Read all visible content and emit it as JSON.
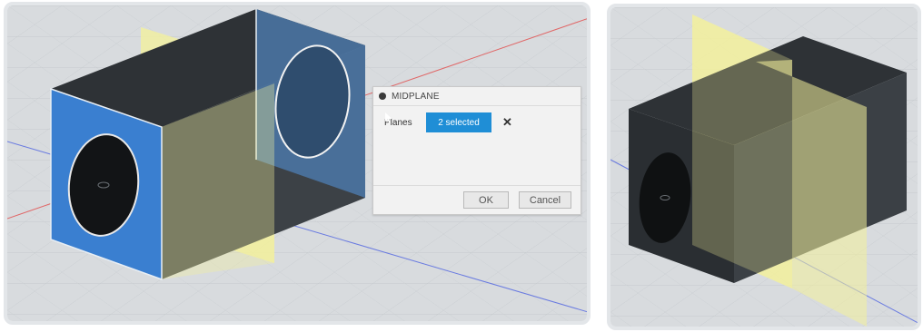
{
  "dialog": {
    "title": "MIDPLANE",
    "planes_label": "Planes",
    "selection_label": "2 selected",
    "clear_glyph": "✕",
    "ok_label": "OK",
    "cancel_label": "Cancel"
  },
  "colors": {
    "viewport_bg": "#d9dcdf",
    "grid_line": "#c3c7cb",
    "selected_face": "#3a7fd0",
    "box_dark": "#2b2f33",
    "midplane_fill": "#f4f19a",
    "select_button": "#1f8ed6",
    "axis_red": "#e35a5a",
    "axis_blue": "#5a6fe0"
  },
  "icons": {
    "title_icon": "dot-icon",
    "selection_icon": "cursor-icon",
    "clear_icon": "close-icon"
  }
}
